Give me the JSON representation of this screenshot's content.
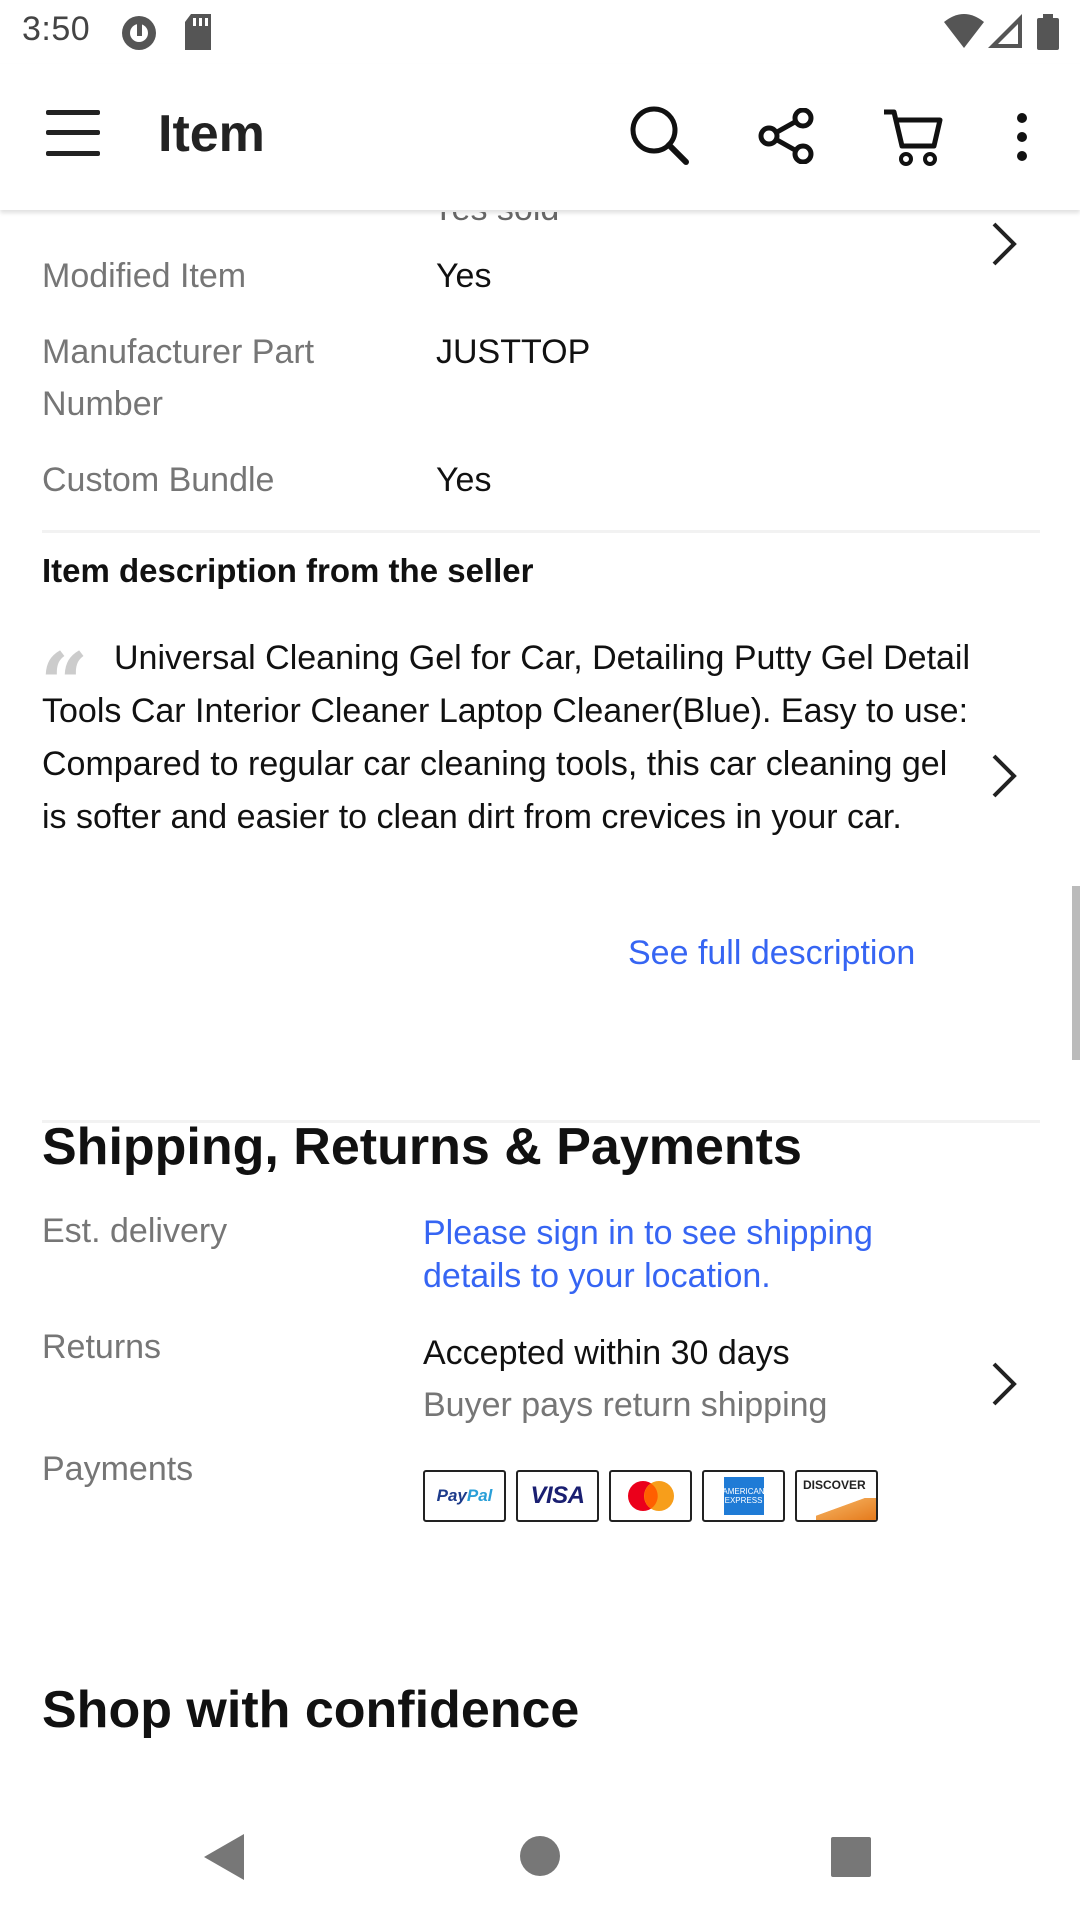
{
  "status_bar": {
    "time": "3:50"
  },
  "app_bar": {
    "title": "Item"
  },
  "specs": {
    "clipped_value": "Yes sold",
    "rows": [
      {
        "label": "Modified Item",
        "value": "Yes"
      },
      {
        "label": "Manufacturer Part Number",
        "value": "JUSTTOP"
      },
      {
        "label": "Custom Bundle",
        "value": "Yes"
      }
    ]
  },
  "description": {
    "heading": "Item description from the seller",
    "text": "Universal Cleaning Gel for Car, Detailing Putty Gel Detail Tools Car Interior Cleaner Laptop Cleaner(Blue). Easy to use: Compared to regular car cleaning tools, this car cleaning gel is softer and easier to clean dirt from crevices in your car.",
    "see_full": "See full description"
  },
  "shipping": {
    "title": "Shipping, Returns & Payments",
    "delivery_label": "Est. delivery",
    "delivery_value": "Please sign in to see shipping details to your location.",
    "returns_label": "Returns",
    "returns_main": "Accepted within 30 days",
    "returns_sub": "Buyer pays return shipping",
    "payments_label": "Payments",
    "payment_methods": {
      "paypal_a": "Pay",
      "paypal_b": "Pal",
      "visa": "VISA",
      "discover": "DISCOVER",
      "amex": "AMERICAN EXPRESS"
    }
  },
  "confidence": {
    "title": "Shop with confidence"
  },
  "colors": {
    "link": "#3665f3",
    "label": "#767676",
    "text": "#111111"
  }
}
